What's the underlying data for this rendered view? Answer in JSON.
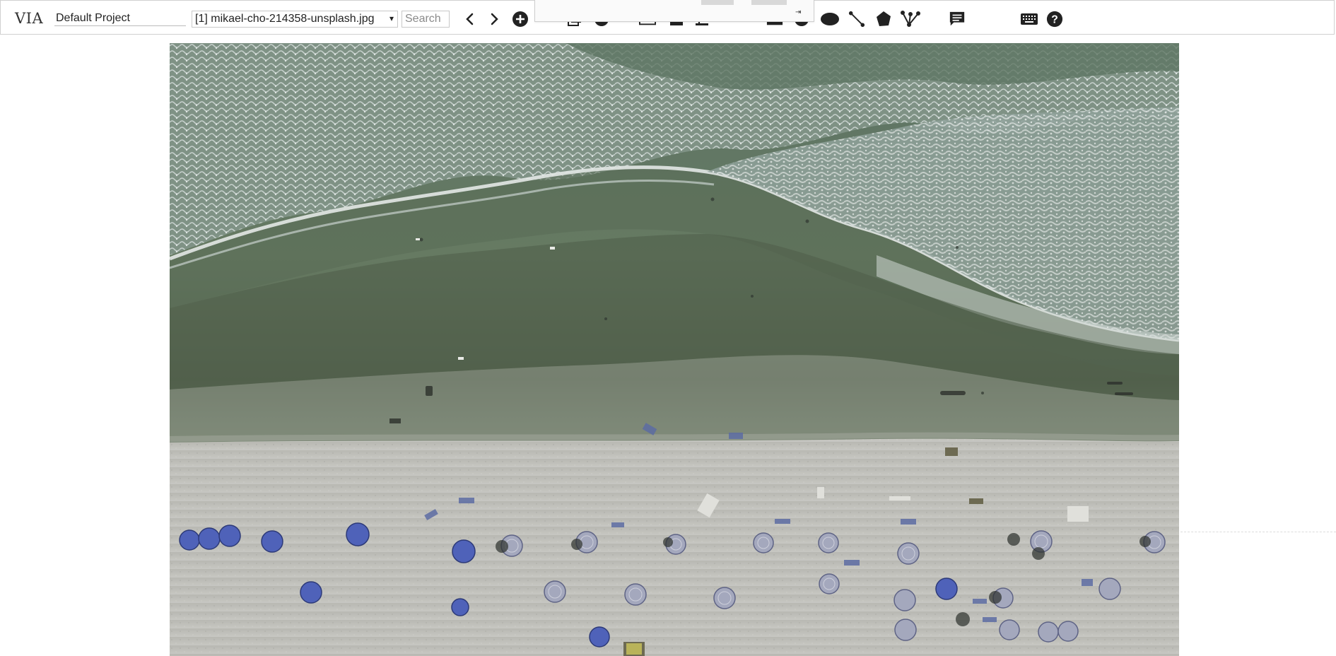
{
  "app": {
    "logo": "VIA",
    "project_name": "Default Project"
  },
  "toolbar": {
    "file_selector": {
      "selected": "[1] mikael-cho-214358-unsplash.jpg",
      "caret": "▾"
    },
    "search": {
      "placeholder": "Search"
    },
    "icons": [
      "prev-image-icon",
      "next-image-icon",
      "add-file-icon",
      "copy-region-icon",
      "circle-region-icon",
      "rect-region-icon",
      "point-region-icon",
      "ellipse-region-icon",
      "polyline-region-icon",
      "polygon-region-icon",
      "polygon-graph-icon",
      "annotation-editor-icon",
      "keyboard-shortcuts-icon",
      "help-icon"
    ],
    "dropdown_arrow": "⇥"
  },
  "colors": {
    "icon": "#222222",
    "border": "#d0d0d0",
    "sea_dark": "#4c5e4a",
    "sea_mid": "#6c806c",
    "foam": "#c9d2cf",
    "sand": "#c2c2be",
    "umbrella_blue": "#4e62b8",
    "umbrella_grey": "#9aa0b8"
  }
}
